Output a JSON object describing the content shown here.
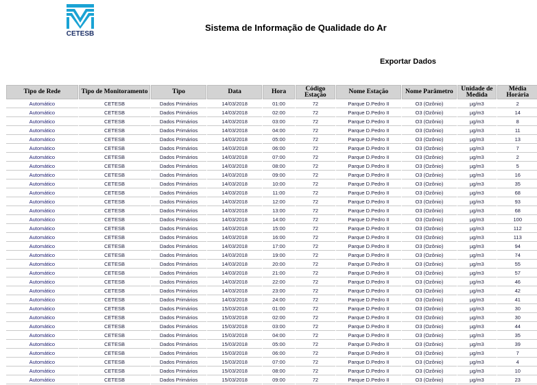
{
  "brand": {
    "logo_text": "CETESB",
    "logo_color": "#1aa3d4"
  },
  "page_title": "Sistema de Informação de Qualidade do Ar",
  "export_label": "Exportar Dados",
  "table": {
    "headers": [
      "Tipo de Rede",
      "Tipo de Monitoramento",
      "Tipo",
      "Data",
      "Hora",
      "Código Estação",
      "Nome Estação",
      "Nome Parâmetro",
      "Unidade de Medida",
      "Média Horária"
    ],
    "rows": [
      [
        "Automático",
        "CETESB",
        "Dados Primários",
        "14/03/2018",
        "01:00",
        "72",
        "Parque D.Pedro II",
        "O3 (Ozônio)",
        "µg/m3",
        "2"
      ],
      [
        "Automático",
        "CETESB",
        "Dados Primários",
        "14/03/2018",
        "02:00",
        "72",
        "Parque D.Pedro II",
        "O3 (Ozônio)",
        "µg/m3",
        "14"
      ],
      [
        "Automático",
        "CETESB",
        "Dados Primários",
        "14/03/2018",
        "03:00",
        "72",
        "Parque D.Pedro II",
        "O3 (Ozônio)",
        "µg/m3",
        "8"
      ],
      [
        "Automático",
        "CETESB",
        "Dados Primários",
        "14/03/2018",
        "04:00",
        "72",
        "Parque D.Pedro II",
        "O3 (Ozônio)",
        "µg/m3",
        "11"
      ],
      [
        "Automático",
        "CETESB",
        "Dados Primários",
        "14/03/2018",
        "05:00",
        "72",
        "Parque D.Pedro II",
        "O3 (Ozônio)",
        "µg/m3",
        "13"
      ],
      [
        "Automático",
        "CETESB",
        "Dados Primários",
        "14/03/2018",
        "06:00",
        "72",
        "Parque D.Pedro II",
        "O3 (Ozônio)",
        "µg/m3",
        "7"
      ],
      [
        "Automático",
        "CETESB",
        "Dados Primários",
        "14/03/2018",
        "07:00",
        "72",
        "Parque D.Pedro II",
        "O3 (Ozônio)",
        "µg/m3",
        "2"
      ],
      [
        "Automático",
        "CETESB",
        "Dados Primários",
        "14/03/2018",
        "08:00",
        "72",
        "Parque D.Pedro II",
        "O3 (Ozônio)",
        "µg/m3",
        "5"
      ],
      [
        "Automático",
        "CETESB",
        "Dados Primários",
        "14/03/2018",
        "09:00",
        "72",
        "Parque D.Pedro II",
        "O3 (Ozônio)",
        "µg/m3",
        "16"
      ],
      [
        "Automático",
        "CETESB",
        "Dados Primários",
        "14/03/2018",
        "10:00",
        "72",
        "Parque D.Pedro II",
        "O3 (Ozônio)",
        "µg/m3",
        "35"
      ],
      [
        "Automático",
        "CETESB",
        "Dados Primários",
        "14/03/2018",
        "11:00",
        "72",
        "Parque D.Pedro II",
        "O3 (Ozônio)",
        "µg/m3",
        "68"
      ],
      [
        "Automático",
        "CETESB",
        "Dados Primários",
        "14/03/2018",
        "12:00",
        "72",
        "Parque D.Pedro II",
        "O3 (Ozônio)",
        "µg/m3",
        "93"
      ],
      [
        "Automático",
        "CETESB",
        "Dados Primários",
        "14/03/2018",
        "13:00",
        "72",
        "Parque D.Pedro II",
        "O3 (Ozônio)",
        "µg/m3",
        "68"
      ],
      [
        "Automático",
        "CETESB",
        "Dados Primários",
        "14/03/2018",
        "14:00",
        "72",
        "Parque D.Pedro II",
        "O3 (Ozônio)",
        "µg/m3",
        "100"
      ],
      [
        "Automático",
        "CETESB",
        "Dados Primários",
        "14/03/2018",
        "15:00",
        "72",
        "Parque D.Pedro II",
        "O3 (Ozônio)",
        "µg/m3",
        "112"
      ],
      [
        "Automático",
        "CETESB",
        "Dados Primários",
        "14/03/2018",
        "16:00",
        "72",
        "Parque D.Pedro II",
        "O3 (Ozônio)",
        "µg/m3",
        "113"
      ],
      [
        "Automático",
        "CETESB",
        "Dados Primários",
        "14/03/2018",
        "17:00",
        "72",
        "Parque D.Pedro II",
        "O3 (Ozônio)",
        "µg/m3",
        "94"
      ],
      [
        "Automático",
        "CETESB",
        "Dados Primários",
        "14/03/2018",
        "19:00",
        "72",
        "Parque D.Pedro II",
        "O3 (Ozônio)",
        "µg/m3",
        "74"
      ],
      [
        "Automático",
        "CETESB",
        "Dados Primários",
        "14/03/2018",
        "20:00",
        "72",
        "Parque D.Pedro II",
        "O3 (Ozônio)",
        "µg/m3",
        "55"
      ],
      [
        "Automático",
        "CETESB",
        "Dados Primários",
        "14/03/2018",
        "21:00",
        "72",
        "Parque D.Pedro II",
        "O3 (Ozônio)",
        "µg/m3",
        "57"
      ],
      [
        "Automático",
        "CETESB",
        "Dados Primários",
        "14/03/2018",
        "22:00",
        "72",
        "Parque D.Pedro II",
        "O3 (Ozônio)",
        "µg/m3",
        "46"
      ],
      [
        "Automático",
        "CETESB",
        "Dados Primários",
        "14/03/2018",
        "23:00",
        "72",
        "Parque D.Pedro II",
        "O3 (Ozônio)",
        "µg/m3",
        "42"
      ],
      [
        "Automático",
        "CETESB",
        "Dados Primários",
        "14/03/2018",
        "24:00",
        "72",
        "Parque D.Pedro II",
        "O3 (Ozônio)",
        "µg/m3",
        "41"
      ],
      [
        "Automático",
        "CETESB",
        "Dados Primários",
        "15/03/2018",
        "01:00",
        "72",
        "Parque D.Pedro II",
        "O3 (Ozônio)",
        "µg/m3",
        "30"
      ],
      [
        "Automático",
        "CETESB",
        "Dados Primários",
        "15/03/2018",
        "02:00",
        "72",
        "Parque D.Pedro II",
        "O3 (Ozônio)",
        "µg/m3",
        "30"
      ],
      [
        "Automático",
        "CETESB",
        "Dados Primários",
        "15/03/2018",
        "03:00",
        "72",
        "Parque D.Pedro II",
        "O3 (Ozônio)",
        "µg/m3",
        "44"
      ],
      [
        "Automático",
        "CETESB",
        "Dados Primários",
        "15/03/2018",
        "04:00",
        "72",
        "Parque D.Pedro II",
        "O3 (Ozônio)",
        "µg/m3",
        "35"
      ],
      [
        "Automático",
        "CETESB",
        "Dados Primários",
        "15/03/2018",
        "05:00",
        "72",
        "Parque D.Pedro II",
        "O3 (Ozônio)",
        "µg/m3",
        "39"
      ],
      [
        "Automático",
        "CETESB",
        "Dados Primários",
        "15/03/2018",
        "06:00",
        "72",
        "Parque D.Pedro II",
        "O3 (Ozônio)",
        "µg/m3",
        "7"
      ],
      [
        "Automático",
        "CETESB",
        "Dados Primários",
        "15/03/2018",
        "07:00",
        "72",
        "Parque D.Pedro II",
        "O3 (Ozônio)",
        "µg/m3",
        "4"
      ],
      [
        "Automático",
        "CETESB",
        "Dados Primários",
        "15/03/2018",
        "08:00",
        "72",
        "Parque D.Pedro II",
        "O3 (Ozônio)",
        "µg/m3",
        "10"
      ],
      [
        "Automático",
        "CETESB",
        "Dados Primários",
        "15/03/2018",
        "09:00",
        "72",
        "Parque D.Pedro II",
        "O3 (Ozônio)",
        "µg/m3",
        "23"
      ]
    ]
  }
}
